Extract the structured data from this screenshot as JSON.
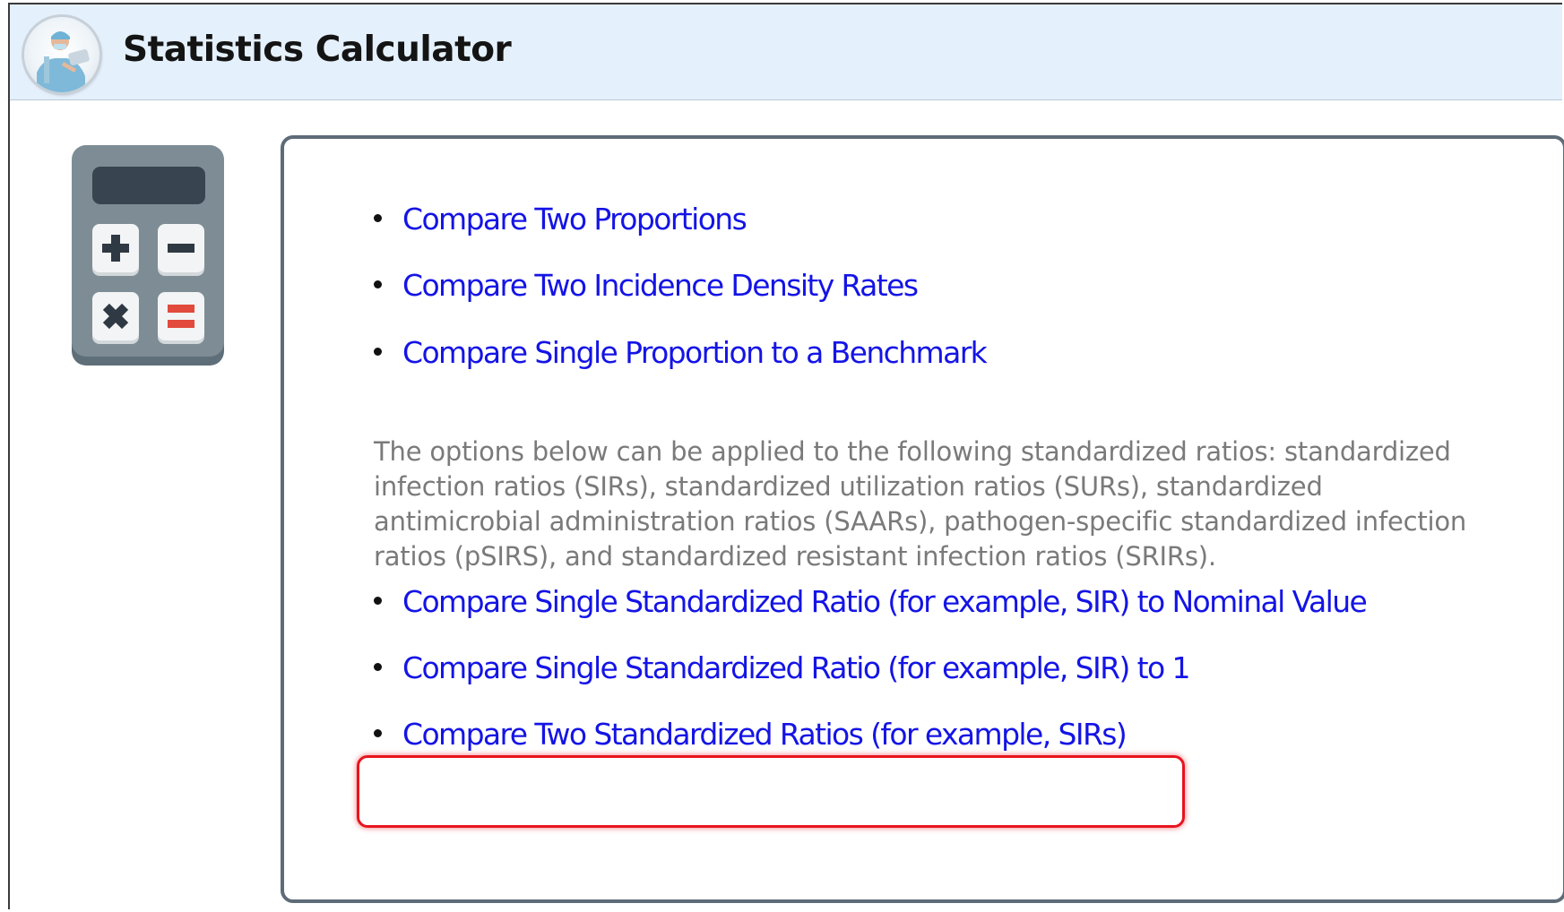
{
  "header": {
    "title": "Statistics Calculator",
    "avatar_icon": "nurse-avatar-icon"
  },
  "sidebar_icon": "calculator-icon",
  "colors": {
    "link": "#1414e6",
    "note_text": "#7a7a7a",
    "header_bg": "#e4f0fb",
    "highlight": "#e8141e",
    "panel_border": "#5e6b78"
  },
  "links_group_1": [
    {
      "label": "Compare Two Proportions"
    },
    {
      "label": "Compare Two Incidence Density Rates"
    },
    {
      "label": "Compare Single Proportion to a Benchmark"
    }
  ],
  "note": "The options below can be applied to the following standardized ratios: standardized infection ratios (SIRs), standardized utilization ratios (SURs), standardized antimicrobial administration ratios (SAARs), pathogen-specific standardized infection ratios (pSIRS), and standardized resistant infection ratios (SRIRs).",
  "links_group_2": [
    {
      "label": "Compare Single Standardized Ratio (for example, SIR) to Nominal Value"
    },
    {
      "label": "Compare Single Standardized Ratio (for example, SIR) to 1"
    },
    {
      "label": "Compare Two Standardized Ratios (for example, SIRs)",
      "highlighted": true
    }
  ]
}
